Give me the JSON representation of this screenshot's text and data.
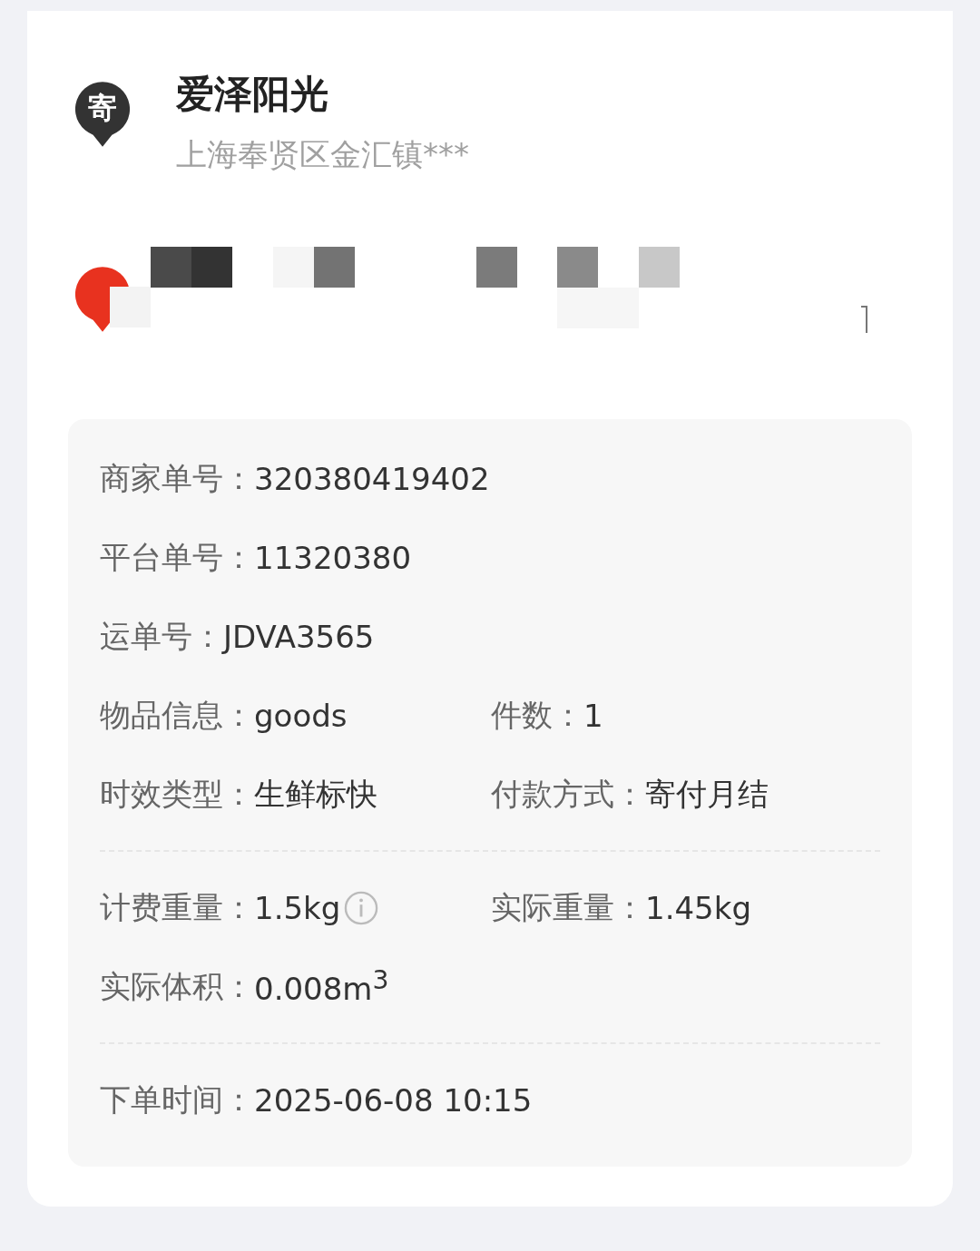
{
  "sender": {
    "badge": "寄",
    "name": "爱泽阳光",
    "address": "上海奉贤区金汇镇***"
  },
  "details": [
    [
      [
        {
          "label": "商家单号：",
          "value": "320380419402"
        }
      ],
      [
        {
          "label": "平台单号：",
          "value": "11320380"
        }
      ],
      [
        {
          "label": "运单号：",
          "value": "JDVA3565"
        }
      ],
      [
        {
          "label": "物品信息：",
          "value": "goods"
        },
        {
          "label": "件数：",
          "value": "1"
        }
      ],
      [
        {
          "label": "时效类型：",
          "value": "生鲜标快"
        },
        {
          "label": "付款方式：",
          "value": "寄付月结"
        }
      ]
    ],
    [
      [
        {
          "label": "计费重量：",
          "value": "1.5kg",
          "info": true
        },
        {
          "label": "实际重量：",
          "value": "1.45kg"
        }
      ],
      [
        {
          "label": "实际体积：",
          "value": "0.008m$^{3}$"
        }
      ]
    ],
    [
      [
        {
          "label": "下单时间：",
          "value": "2025-06-08 10:15"
        }
      ]
    ]
  ]
}
